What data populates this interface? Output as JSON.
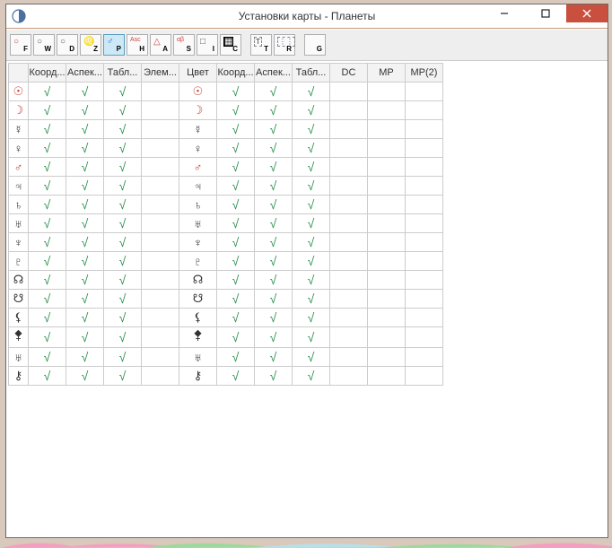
{
  "window": {
    "title": "Установки карты - Планеты"
  },
  "toolbar": [
    {
      "sym": "○",
      "letter": "F",
      "name": "tool-f",
      "color": "#c44"
    },
    {
      "sym": "○",
      "letter": "W",
      "name": "tool-w",
      "color": "#555"
    },
    {
      "sym": "○",
      "letter": "D",
      "name": "tool-d",
      "color": "#555"
    },
    {
      "sym": "♌",
      "letter": "Z",
      "name": "tool-z",
      "color": "#c44"
    },
    {
      "sym": "♂",
      "letter": "P",
      "name": "tool-p",
      "color": "#2a6dbf",
      "pressed": true
    },
    {
      "sym": "Asc",
      "letter": "H",
      "name": "tool-h",
      "color": "#c44",
      "small": true
    },
    {
      "sym": "△",
      "letter": "A",
      "name": "tool-a",
      "color": "#c44"
    },
    {
      "sym": "αβ",
      "letter": "S",
      "name": "tool-s",
      "color": "#c44",
      "small": true
    },
    {
      "sym": "□",
      "letter": "I",
      "name": "tool-i",
      "color": "#555"
    },
    {
      "sym": "▦",
      "letter": "C",
      "name": "tool-c",
      "color": "#fff",
      "bg": "#000"
    },
    {
      "sep": true
    },
    {
      "sym": "T",
      "letter": "T",
      "name": "tool-t",
      "color": "#333",
      "boxed": true
    },
    {
      "sym": "⋮⋮",
      "letter": "R",
      "name": "tool-r",
      "color": "#2a6dbf",
      "boxed": true
    },
    {
      "sep": true
    },
    {
      "sym": "",
      "letter": "G",
      "name": "tool-g",
      "color": "#333"
    }
  ],
  "columns": [
    "",
    "Коорд...",
    "Аспек...",
    "Табл...",
    "Элем...",
    "Цвет",
    "Коорд...",
    "Аспек...",
    "Табл...",
    "DC",
    "MP",
    "MP(2)"
  ],
  "chart_data": {
    "type": "table",
    "planets": [
      {
        "name": "Sun",
        "sym": "☉",
        "red": true,
        "c": [
          1,
          1,
          1,
          0,
          0,
          1,
          1,
          1,
          0,
          0,
          0
        ]
      },
      {
        "name": "Moon",
        "sym": "☽",
        "red": true,
        "c": [
          1,
          1,
          1,
          0,
          0,
          1,
          1,
          1,
          0,
          0,
          0
        ]
      },
      {
        "name": "Mercury",
        "sym": "☿",
        "red": false,
        "c": [
          1,
          1,
          1,
          0,
          0,
          1,
          1,
          1,
          0,
          0,
          0
        ]
      },
      {
        "name": "Venus",
        "sym": "♀",
        "red": false,
        "c": [
          1,
          1,
          1,
          0,
          0,
          1,
          1,
          1,
          0,
          0,
          0
        ]
      },
      {
        "name": "Mars",
        "sym": "♂",
        "red": true,
        "c": [
          1,
          1,
          1,
          0,
          0,
          1,
          1,
          1,
          0,
          0,
          0
        ]
      },
      {
        "name": "Jupiter",
        "sym": "♃",
        "red": false,
        "c": [
          1,
          1,
          1,
          0,
          0,
          1,
          1,
          1,
          0,
          0,
          0
        ]
      },
      {
        "name": "Saturn",
        "sym": "♄",
        "red": false,
        "c": [
          1,
          1,
          1,
          0,
          0,
          1,
          1,
          1,
          0,
          0,
          0
        ]
      },
      {
        "name": "Uranus",
        "sym": "♅",
        "red": false,
        "c": [
          1,
          1,
          1,
          0,
          0,
          1,
          1,
          1,
          0,
          0,
          0
        ]
      },
      {
        "name": "Neptune",
        "sym": "♆",
        "red": false,
        "c": [
          1,
          1,
          1,
          0,
          0,
          1,
          1,
          1,
          0,
          0,
          0
        ]
      },
      {
        "name": "Pluto",
        "sym": "♇",
        "red": false,
        "c": [
          1,
          1,
          1,
          0,
          0,
          1,
          1,
          1,
          0,
          0,
          0
        ]
      },
      {
        "name": "North Node",
        "sym": "☊",
        "red": false,
        "c": [
          1,
          1,
          1,
          0,
          0,
          1,
          1,
          1,
          0,
          0,
          0
        ]
      },
      {
        "name": "South Node",
        "sym": "☋",
        "red": false,
        "c": [
          1,
          1,
          1,
          0,
          0,
          1,
          1,
          1,
          0,
          0,
          0
        ]
      },
      {
        "name": "Lilith",
        "sym": "⚸",
        "red": false,
        "c": [
          1,
          1,
          1,
          0,
          0,
          1,
          1,
          1,
          0,
          0,
          0
        ]
      },
      {
        "name": "Selena",
        "sym": "⯞",
        "red": false,
        "c": [
          1,
          1,
          1,
          0,
          0,
          1,
          1,
          1,
          0,
          0,
          0
        ]
      },
      {
        "name": "Proserpina",
        "sym": "♅",
        "red": false,
        "c": [
          1,
          1,
          1,
          0,
          0,
          1,
          1,
          1,
          0,
          0,
          0
        ]
      },
      {
        "name": "Chiron",
        "sym": "⚷",
        "red": false,
        "c": [
          1,
          1,
          1,
          0,
          0,
          1,
          1,
          1,
          0,
          0,
          0
        ]
      }
    ]
  },
  "check_glyph": "√"
}
